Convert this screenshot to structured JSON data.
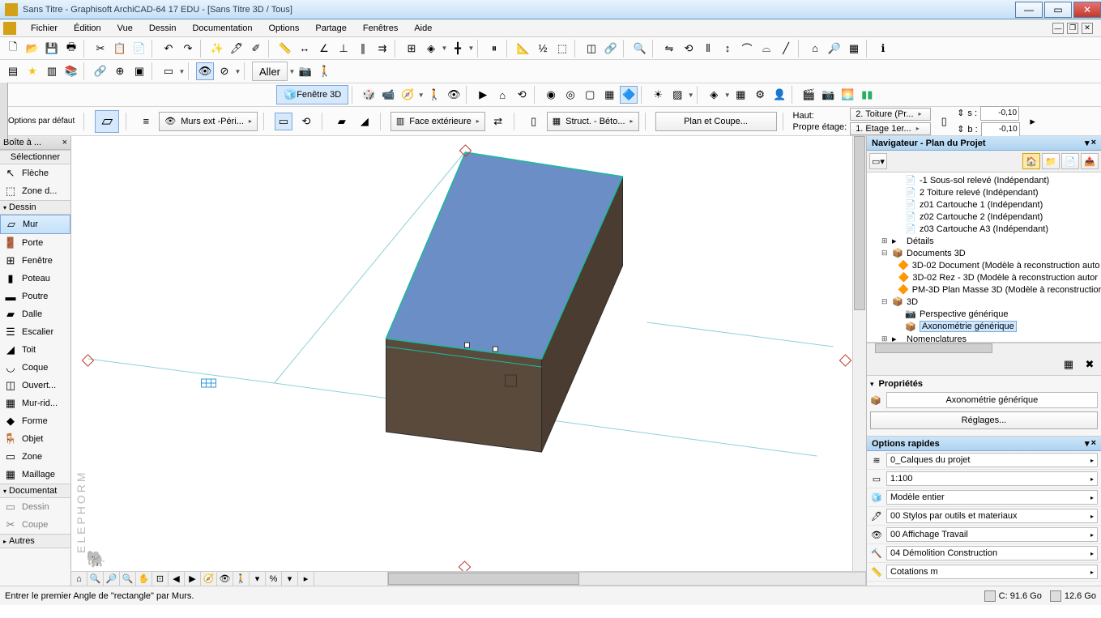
{
  "title": "Sans Titre - Graphisoft ArchiCAD-64 17 EDU - [Sans Titre 3D / Tous]",
  "menu": [
    "Fichier",
    "Édition",
    "Vue",
    "Dessin",
    "Documentation",
    "Options",
    "Partage",
    "Fenêtres",
    "Aide"
  ],
  "toolbar2_goto": "Aller",
  "tb3_window": "Fenêtre 3D",
  "opts": {
    "defaults": "Options par défaut",
    "layer": "Murs ext -Péri...",
    "face": "Face extérieure",
    "struct": "Struct. - Béto...",
    "plan": "Plan et Coupe...",
    "height_lbl": "Haut:",
    "floor_lbl": "Propre étage:",
    "top_link": "2. Toiture (Pr...",
    "own_story": "1. Etage 1er...",
    "s": "-0,10",
    "b": "-0,10",
    "s_lbl": "s :",
    "b_lbl": "b :"
  },
  "toolbox": {
    "title": "Boîte à ...",
    "select": "Sélectionner",
    "arrow": "Flèche",
    "zone_d": "Zone d...",
    "draw": "Dessin",
    "wall": "Mur",
    "door": "Porte",
    "window": "Fenêtre",
    "column": "Poteau",
    "beam": "Poutre",
    "slab": "Dalle",
    "stair": "Escalier",
    "roof": "Toit",
    "shell": "Coque",
    "opening": "Ouvert...",
    "curtain": "Mur-rid...",
    "morph": "Forme",
    "object": "Objet",
    "zone": "Zone",
    "mesh": "Maillage",
    "doc": "Documentat",
    "drawing": "Dessin",
    "section": "Coupe",
    "others": "Autres"
  },
  "navigator": {
    "title": "Navigateur - Plan du Projet",
    "items": [
      {
        "l": 2,
        "ico": "📄",
        "txt": "-1 Sous-sol relevé (Indépendant)"
      },
      {
        "l": 2,
        "ico": "📄",
        "txt": "2 Toiture relevé (Indépendant)"
      },
      {
        "l": 2,
        "ico": "📄",
        "txt": "z01 Cartouche 1 (Indépendant)"
      },
      {
        "l": 2,
        "ico": "📄",
        "txt": "z02 Cartouche 2 (Indépendant)"
      },
      {
        "l": 2,
        "ico": "📄",
        "txt": "z03 Cartouche A3 (Indépendant)"
      },
      {
        "l": 1,
        "ico": "▸",
        "txt": "Détails",
        "exp": "⊞"
      },
      {
        "l": 1,
        "ico": "📦",
        "txt": "Documents 3D",
        "exp": "⊟"
      },
      {
        "l": 2,
        "ico": "🔶",
        "txt": "3D-02 Document (Modèle à reconstruction auto"
      },
      {
        "l": 2,
        "ico": "🔶",
        "txt": "3D-02 Rez - 3D (Modèle à reconstruction autor"
      },
      {
        "l": 2,
        "ico": "🔶",
        "txt": "PM-3D Plan Masse 3D (Modèle à reconstructior"
      },
      {
        "l": 1,
        "ico": "📦",
        "txt": "3D",
        "exp": "⊟"
      },
      {
        "l": 2,
        "ico": "📷",
        "txt": "Perspective générique"
      },
      {
        "l": 2,
        "ico": "📦",
        "txt": "Axonométrie générique",
        "sel": true
      },
      {
        "l": 1,
        "ico": "▸",
        "txt": "Nomenclatures",
        "exp": "⊞"
      }
    ],
    "props_title": "Propriétés",
    "prop_value": "Axonométrie générique",
    "settings": "Réglages..."
  },
  "quick": {
    "title": "Options rapides",
    "rows": [
      "0_Calques du projet",
      "1:100",
      "Modèle entier",
      "00 Stylos par outils et materiaux",
      "00 Affichage Travail",
      "04 Démolition Construction",
      "Cotations m"
    ]
  },
  "status": {
    "hint": "Entrer le premier Angle de \"rectangle\" par Murs.",
    "diskC": "C: 91.6 Go",
    "diskD": "12.6 Go"
  },
  "watermark": "ELEPHORM"
}
